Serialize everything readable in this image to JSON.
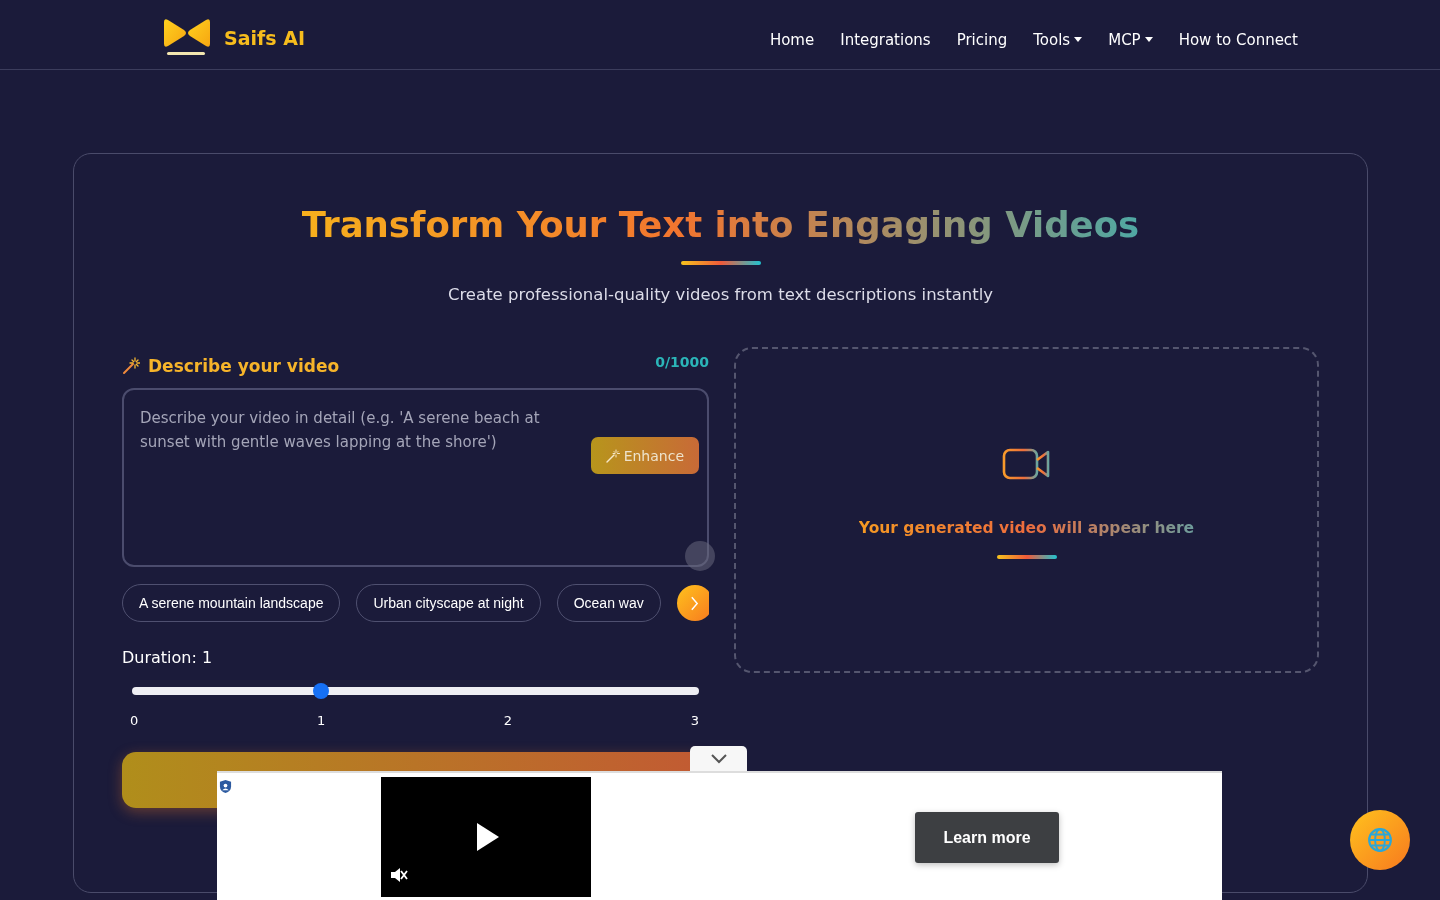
{
  "brand": {
    "name": "Saifs AI"
  },
  "nav": [
    {
      "label": "Home",
      "dropdown": false
    },
    {
      "label": "Integrations",
      "dropdown": false
    },
    {
      "label": "Pricing",
      "dropdown": false
    },
    {
      "label": "Tools",
      "dropdown": true
    },
    {
      "label": "MCP",
      "dropdown": true
    },
    {
      "label": "How to Connect",
      "dropdown": false
    }
  ],
  "hero": {
    "title": "Transform Your Text into Engaging Videos",
    "subtitle": "Create professional-quality videos from text descriptions instantly"
  },
  "prompt": {
    "label": "Describe your video",
    "counter": "0/1000",
    "placeholder": "Describe your video in detail (e.g. 'A serene beach at sunset with gentle waves lapping at the shore')",
    "enhance": "Enhance"
  },
  "suggestions": [
    "A serene mountain landscape",
    "Urban cityscape at night",
    "Ocean wav"
  ],
  "duration": {
    "label": "Duration: 1",
    "level": 0.3333,
    "ticks": [
      "0",
      "1",
      "2",
      "3"
    ]
  },
  "preview": {
    "message": "Your generated video will appear here"
  },
  "ad": {
    "button": "Learn more"
  }
}
